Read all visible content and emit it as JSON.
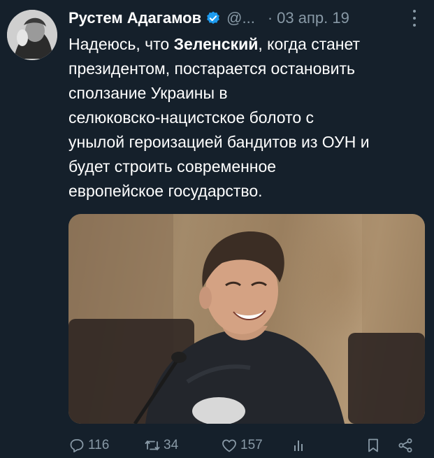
{
  "author": {
    "name": "Рустем Адагамов",
    "handle": "@...",
    "separator": "·",
    "date": "03 апр. 19"
  },
  "tweet": {
    "line1_pre": "Надеюсь, что ",
    "line1_bold": "Зеленский",
    "line1_post": ", когда станет",
    "line2": "президентом, постарается остановить",
    "line3": "сползание Украины в",
    "line4": "селюковско-нацистское болото с",
    "line5": "унылой героизацией бандитов из ОУН и",
    "line6": "будет строить современное",
    "line7": "европейское государство."
  },
  "actions": {
    "reply_count": "116",
    "retweet_count": "34",
    "like_count": "157"
  },
  "colors": {
    "background": "#15202b",
    "muted": "#8899a6",
    "verified": "#1d9bf0"
  },
  "icons": [
    "verified-badge-icon",
    "more-icon",
    "reply-icon",
    "retweet-icon",
    "like-icon",
    "analytics-icon",
    "bookmark-icon",
    "share-icon"
  ]
}
